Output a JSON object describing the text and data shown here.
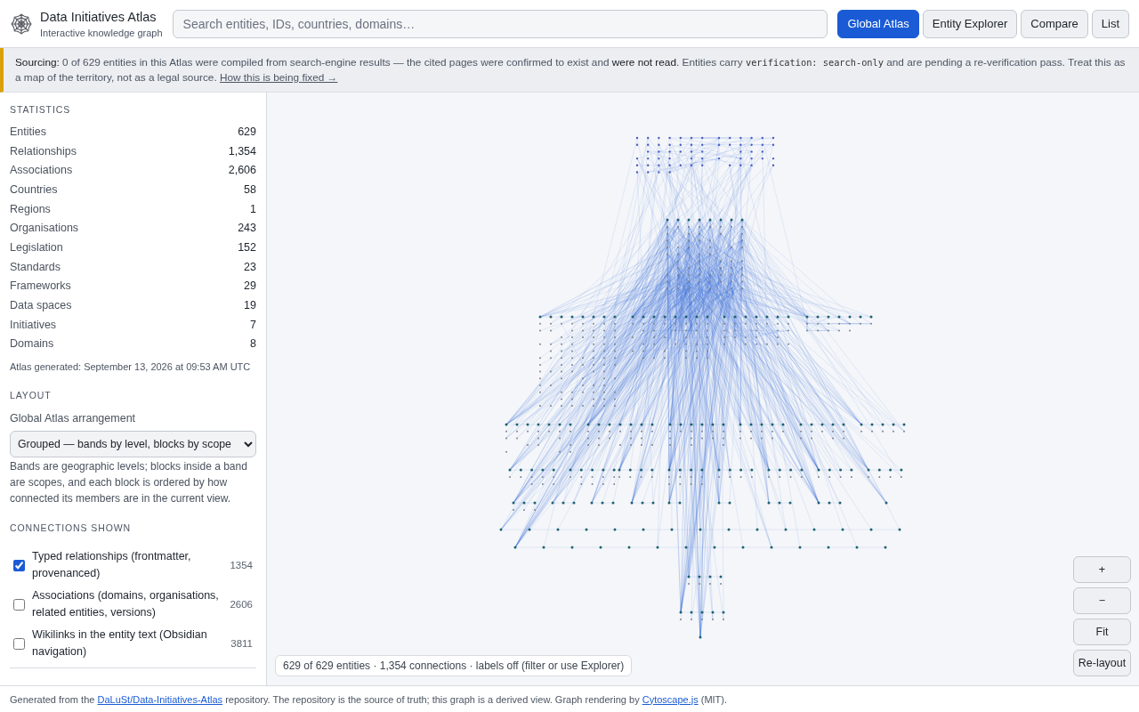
{
  "header": {
    "title": "Data Initiatives Atlas",
    "subtitle": "Interactive knowledge graph",
    "search": {
      "placeholder": "Search entities, IDs, countries, domains…"
    },
    "nav": [
      {
        "label": "Global Atlas",
        "selected": true
      },
      {
        "label": "Entity Explorer",
        "selected": false
      },
      {
        "label": "Compare",
        "selected": false
      },
      {
        "label": "List",
        "selected": false
      }
    ]
  },
  "notice": {
    "parts": [
      {
        "kind": "label",
        "text": "Sourcing:"
      },
      {
        "kind": "text",
        "text": " 0 of 629 entities in this Atlas were compiled from search-engine results — the cited pages were confirmed to exist and "
      },
      {
        "kind": "emphasis",
        "text": "were not read"
      },
      {
        "kind": "text",
        "text": ". Entities carry "
      },
      {
        "kind": "code",
        "text": "verification: search-only"
      },
      {
        "kind": "text",
        "text": " and are pending a re-verification pass. Treat this as a map of the territory, not as a legal source. "
      },
      {
        "kind": "link",
        "text": "How this is being fixed →"
      }
    ]
  },
  "statistics": {
    "heading": "STATISTICS",
    "rows": [
      {
        "label": "Entities",
        "value": "629"
      },
      {
        "label": "Relationships",
        "value": "1,354"
      },
      {
        "label": "Associations",
        "value": "2,606"
      },
      {
        "label": "Countries",
        "value": "58"
      },
      {
        "label": "Regions",
        "value": "1"
      },
      {
        "label": "Organisations",
        "value": "243"
      },
      {
        "label": "Legislation",
        "value": "152"
      },
      {
        "label": "Standards",
        "value": "23"
      },
      {
        "label": "Frameworks",
        "value": "29"
      },
      {
        "label": "Data spaces",
        "value": "19"
      },
      {
        "label": "Initiatives",
        "value": "7"
      },
      {
        "label": "Domains",
        "value": "8"
      }
    ],
    "generated": "Atlas generated: September 13, 2026 at 09:53 AM UTC"
  },
  "layout": {
    "heading": "LAYOUT",
    "label": "Global Atlas arrangement",
    "select": {
      "value": "Grouped — bands by level, blocks by scope"
    },
    "description": "Bands are geographic levels; blocks inside a band are scopes, and each block is ordered by how connected its members are in the current view."
  },
  "connections": {
    "heading": "CONNECTIONS SHOWN",
    "items": [
      {
        "label": "Typed relationships (frontmatter, provenanced)",
        "count": "1354",
        "checked": true
      },
      {
        "label": "Associations (domains, organisations, related entities, versions)",
        "count": "2606",
        "checked": false
      },
      {
        "label": "Wikilinks in the entity text (Obsidian navigation)",
        "count": "3811",
        "checked": false
      }
    ]
  },
  "graph": {
    "status": "629 of 629 entities · 1,354 connections · labels off (filter or use Explorer)",
    "controls": [
      "+",
      "−",
      "Fit",
      "Re-layout"
    ]
  },
  "footer": {
    "parts": [
      {
        "kind": "text",
        "text": "Generated from the "
      },
      {
        "kind": "link",
        "text": "DaLuSt/Data-Initiatives-Atlas"
      },
      {
        "kind": "text",
        "text": " repository. The repository is the source of truth; this graph is a derived view. Graph rendering by "
      },
      {
        "kind": "link",
        "text": "Cytoscape.js"
      },
      {
        "kind": "text",
        "text": " (MIT)."
      }
    ]
  }
}
